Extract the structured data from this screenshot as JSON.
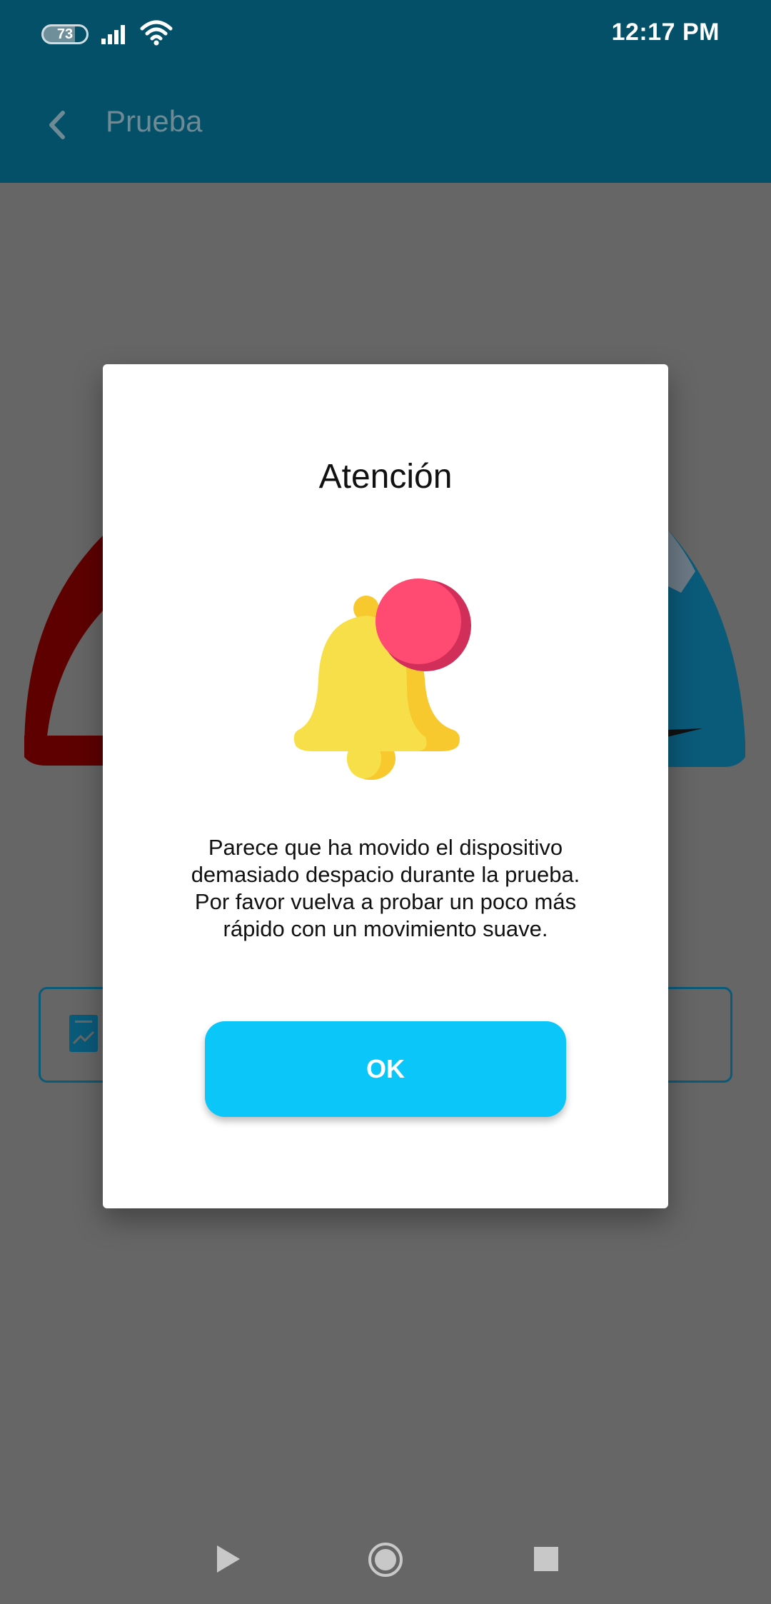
{
  "status_bar": {
    "battery_level": "73",
    "time": "12:17 PM"
  },
  "app_bar": {
    "title": "Prueba"
  },
  "dialog": {
    "title": "Atención",
    "message": "Parece que ha movido el dispositivo demasiado despacio durante la prueba. Por favor vuelva a probar un poco más rápido con un movimiento suave.",
    "ok_label": "OK",
    "icon": "bell-notification-icon"
  },
  "colors": {
    "app_bar": "#045068",
    "scrim": "#666666",
    "ok_button": "#0ac6f9",
    "bell": "#f7df4a",
    "notification_dot": "#ff4a71"
  }
}
